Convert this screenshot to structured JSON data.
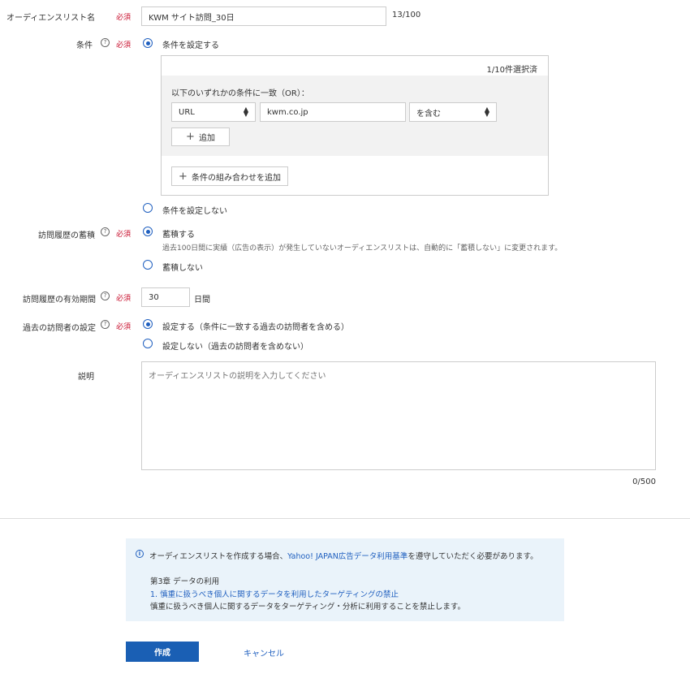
{
  "audience_name": {
    "label": "オーディエンスリスト名",
    "required": "必須",
    "value": "KWM サイト訪問_30日",
    "counter": "13/100"
  },
  "condition": {
    "label": "条件",
    "required": "必須",
    "help": "?",
    "option_set": "条件を設定する",
    "option_unset": "条件を設定しない",
    "selected_count": "1/10件選択済",
    "match_label": "以下のいずれかの条件に一致（OR）：",
    "field_select": "URL",
    "value_input": "kwm.co.jp",
    "operator_select": "を含む",
    "add_button": "追加",
    "add_combination_button": "条件の組み合わせを追加"
  },
  "visit_history": {
    "label": "訪問履歴の蓄積",
    "required": "必須",
    "help": "?",
    "option_store": "蓄積する",
    "note": "過去100日間に実績（広告の表示）が発生していないオーディエンスリストは、自動的に「蓄積しない」に変更されます。",
    "option_no_store": "蓄積しない"
  },
  "validity": {
    "label": "訪問履歴の有効期間",
    "required": "必須",
    "help": "?",
    "value": "30",
    "unit": "日間"
  },
  "past_visitors": {
    "label": "過去の訪問者の設定",
    "required": "必須",
    "help": "?",
    "option_set": "設定する（条件に一致する過去の訪問者を含める）",
    "option_unset": "設定しない（過去の訪問者を含めない）"
  },
  "description": {
    "label": "説明",
    "placeholder": "オーディエンスリストの説明を入力してください",
    "counter": "0/500"
  },
  "notice": {
    "icon": "info-icon",
    "text_before": "オーディエンスリストを作成する場合、",
    "link": "Yahoo! JAPAN広告データ利用基準",
    "text_after": "を遵守していただく必要があります。",
    "chapter": "第3章 データの利用",
    "item_link": "1. 慎重に扱うべき個人に関するデータを利用したターゲティングの禁止",
    "item_text": "慎重に扱うべき個人に関するデータをターゲティング・分析に利用することを禁止します。"
  },
  "actions": {
    "create": "作成",
    "cancel": "キャンセル"
  },
  "colors": {
    "accent": "#1f5fbf",
    "required": "#c8102e",
    "notice_bg": "#eaf3fa",
    "primary_button": "#1a5fb4"
  }
}
